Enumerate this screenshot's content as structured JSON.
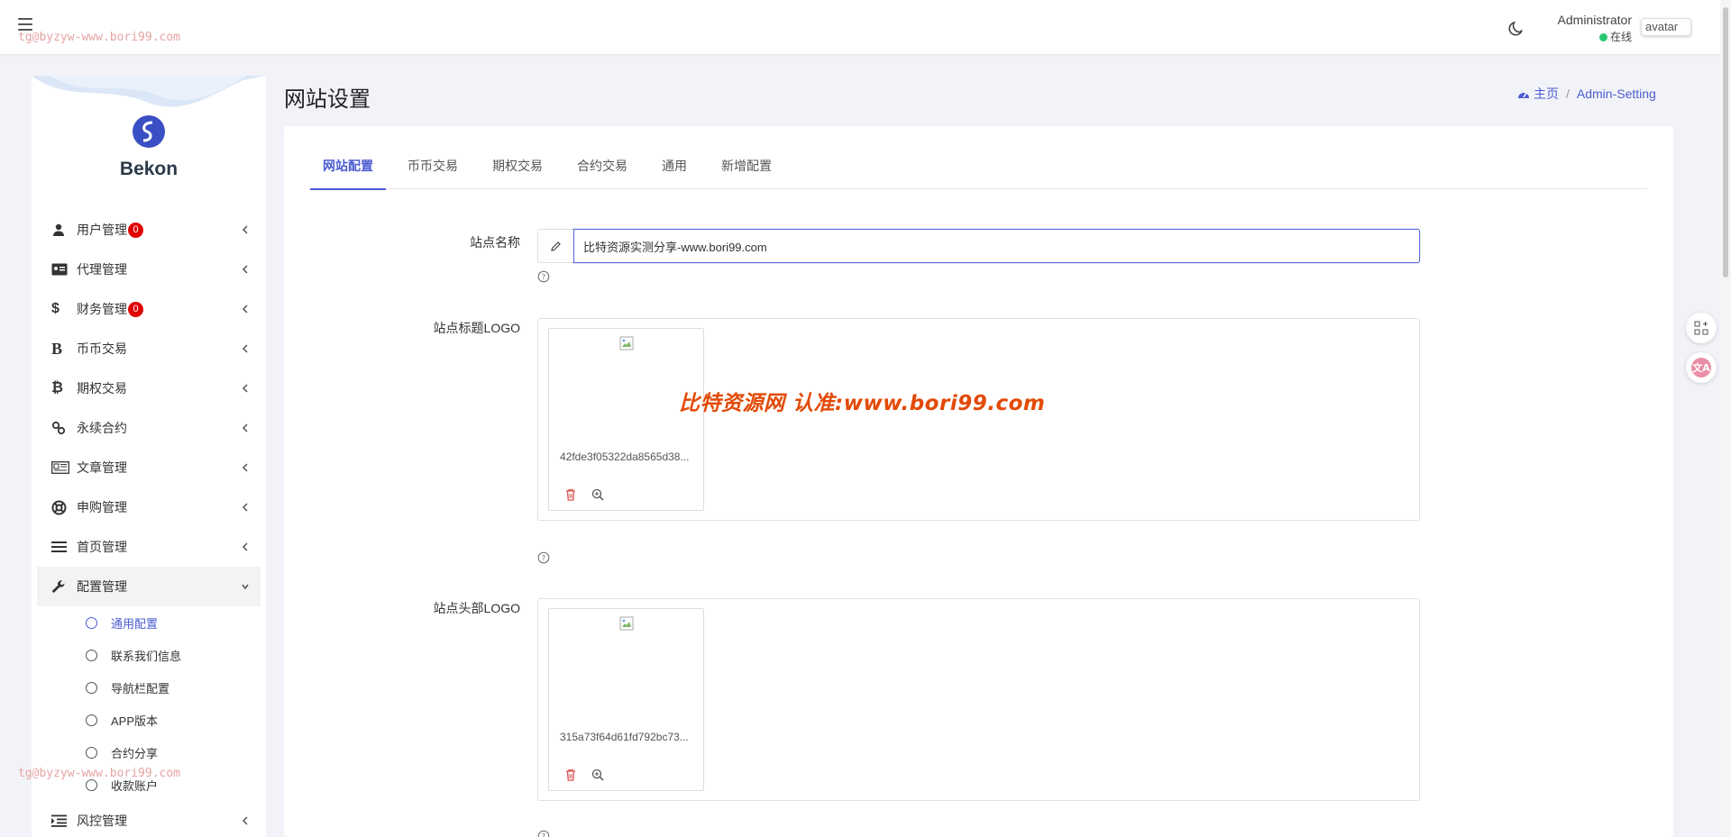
{
  "header": {
    "watermark": "tg@byzyw-www.bori99.com",
    "user_name": "Administrator",
    "user_status": "在线",
    "avatar_alt": "avatar"
  },
  "brand": {
    "name": "Bekon"
  },
  "sidebar": {
    "items": [
      {
        "label": "用户管理",
        "icon": "user-secret-icon",
        "badge": "0"
      },
      {
        "label": "代理管理",
        "icon": "id-card-icon"
      },
      {
        "label": "财务管理",
        "icon": "dollar-icon",
        "badge": "0"
      },
      {
        "label": "币币交易",
        "icon": "bold-b-icon"
      },
      {
        "label": "期权交易",
        "icon": "bitcoin-icon"
      },
      {
        "label": "永续合约",
        "icon": "link-icon"
      },
      {
        "label": "文章管理",
        "icon": "newspaper-icon"
      },
      {
        "label": "申购管理",
        "icon": "life-ring-icon"
      },
      {
        "label": "首页管理",
        "icon": "bars-icon"
      },
      {
        "label": "配置管理",
        "icon": "wrench-icon"
      },
      {
        "label": "风控管理",
        "icon": "indent-icon"
      }
    ],
    "subitems": [
      {
        "label": "通用配置"
      },
      {
        "label": "联系我们信息"
      },
      {
        "label": "导航栏配置"
      },
      {
        "label": "APP版本"
      },
      {
        "label": "合约分享"
      },
      {
        "label": "收款账户"
      }
    ],
    "watermark": "tg@byzyw-www.bori99.com"
  },
  "page": {
    "title": "网站设置",
    "breadcrumb_home": "主页",
    "breadcrumb_current": "Admin-Setting"
  },
  "tabs": [
    {
      "label": "网站配置"
    },
    {
      "label": "币币交易"
    },
    {
      "label": "期权交易"
    },
    {
      "label": "合约交易"
    },
    {
      "label": "通用"
    },
    {
      "label": "新增配置"
    }
  ],
  "form": {
    "site_name_label": "站点名称",
    "site_name_value": "比特资源实测分享-www.bori99.com",
    "title_logo_label": "站点标题LOGO",
    "title_logo_file": "42fde3f05322da8565d38...",
    "header_logo_label": "站点头部LOGO",
    "header_logo_file": "315a73f64d61fd792bc73..."
  },
  "overlay_watermark": "比特资源网 认准:www.bori99.com",
  "colors": {
    "accent": "#4a5cd1",
    "badge": "#e10000",
    "online": "#28c76f",
    "watermark": "#e34a06"
  }
}
